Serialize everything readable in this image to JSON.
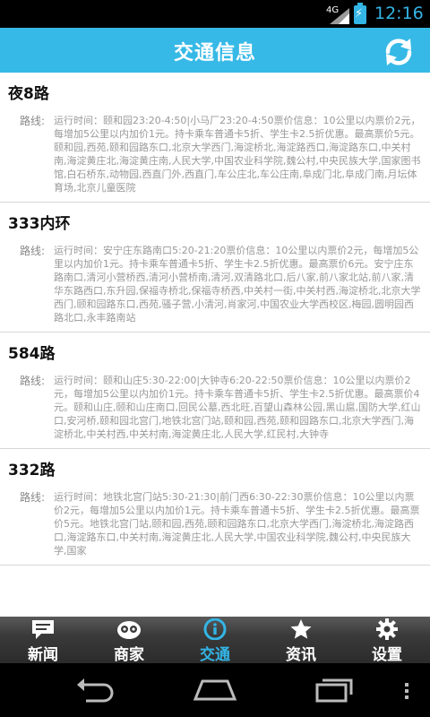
{
  "status_bar": {
    "network": "4G",
    "time": "12:16"
  },
  "title_bar": {
    "title": "交通信息"
  },
  "routes": [
    {
      "name": "夜8路",
      "label": "路线:",
      "text": "运行时间：颐和园23:20-4:50|小马厂23:20-4:50票价信息：10公里以内票价2元，每增加5公里以内加价1元。持卡乘车普通卡5折、学生卡2.5折优惠。最高票价5元。颐和园,西苑,颐和园路东口,北京大学西门,海淀桥北,海淀路西口,海淀路东口,中关村南,海淀黄庄北,海淀黄庄南,人民大学,中国农业科学院,魏公村,中央民族大学,国家图书馆,白石桥东,动物园,西直门外,西直门,车公庄北,车公庄南,阜成门北,阜成门南,月坛体育场,北京儿童医院"
    },
    {
      "name": "333内环",
      "label": "路线:",
      "text": "运行时间：安宁庄东路南口5:20-21:20票价信息：10公里以内票价2元，每增加5公里以内加价1元。持卡乘车普通卡5折、学生卡2.5折优惠。最高票价6元。安宁庄东路南口,清河小营桥西,清河小营桥南,清河,双清路北口,后八家,前八家北站,前八家,清华东路西口,东升园,保福寺桥北,保福寺桥西,中关村一街,中关村西,海淀桥北,北京大学西门,颐和园路东口,西苑,骚子营,小清河,肖家河,中国农业大学西校区,梅园,圆明园西路北口,永丰路南站"
    },
    {
      "name": "584路",
      "label": "路线:",
      "text": "运行时间：颐和山庄5:30-22:00|大钟寺6:20-22:50票价信息：10公里以内票价2元，每增加5公里以内加价1元。持卡乘车普通卡5折、学生卡2.5折优惠。最高票价4元。颐和山庄,颐和山庄南口,回民公墓,西北旺,百望山森林公园,黑山扈,国防大学,红山口,安河桥,颐和园北宫门,地铁北宫门站,颐和园,西苑,颐和园路东口,北京大学西门,海淀桥北,中关村西,中关村南,海淀黄庄北,人民大学,红民村,大钟寺"
    },
    {
      "name": "332路",
      "label": "路线:",
      "text": "运行时间：地铁北宫门站5:30-21:30|前门西6:30-22:30票价信息：10公里以内票价2元，每增加5公里以内加价1元。持卡乘车普通卡5折、学生卡2.5折优惠。最高票价5元。地铁北宫门站,颐和园,西苑,颐和园路东口,北京大学西门,海淀桥北,海淀路西口,海淀路东口,中关村南,海淀黄庄北,人民大学,中国农业科学院,魏公村,中央民族大学,国家"
    }
  ],
  "tabs": [
    {
      "label": "新闻",
      "icon": "chat-bubble-icon"
    },
    {
      "label": "商家",
      "icon": "owl-face-icon"
    },
    {
      "label": "交通",
      "icon": "info-icon"
    },
    {
      "label": "资讯",
      "icon": "star-icon"
    },
    {
      "label": "设置",
      "icon": "gear-icon"
    }
  ],
  "active_tab": "交通",
  "colors": {
    "accent": "#36b9e6",
    "active_tab_text": "#33b5e5"
  }
}
